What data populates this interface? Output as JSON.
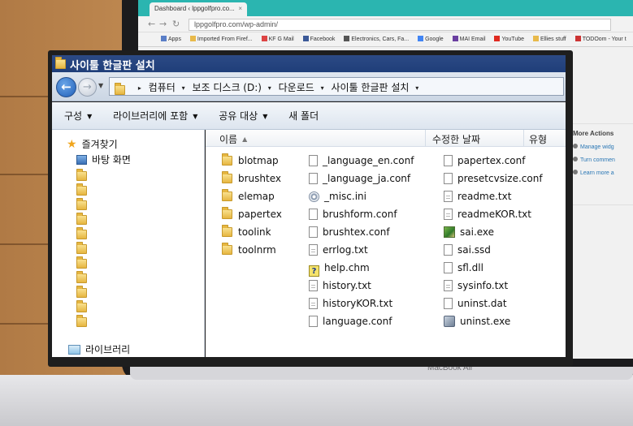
{
  "browser": {
    "tab_title": "Dashboard ‹ lppgolfpro.co...",
    "tab_close": "×",
    "url": "lppgolfpro.com/wp-admin/",
    "bookmarks": [
      "Apps",
      "Imported From Firef...",
      "KF G Mail",
      "Facebook",
      "Electronics, Cars, Fa...",
      "Google",
      "MAI Email",
      "YouTube",
      "Ellies stuff",
      "TODOom - Your t"
    ],
    "sidebar": {
      "heading": "More Actions",
      "links": [
        "Manage widg",
        "Turn commen",
        "Learn more a"
      ]
    }
  },
  "laptop": {
    "label": "MacBook Air"
  },
  "window": {
    "title": "사이툴 한글판 설치",
    "address": [
      "컴퓨터",
      "보조 디스크 (D:)",
      "다운로드",
      "사이툴 한글판 설치"
    ],
    "toolbar": [
      "구성",
      "라이브러리에 포함",
      "공유 대상",
      "새 폴더"
    ],
    "navpane": {
      "favorites": "즐겨찾기",
      "desktop": "바탕 화면",
      "libraries": "라이브러리"
    },
    "columns": {
      "name": "이름",
      "modified": "수정한 날짜",
      "type": "유형"
    },
    "files_col1": [
      "blotmap",
      "brushtex",
      "elemap",
      "papertex",
      "toolink",
      "toolnrm"
    ],
    "files_col2": [
      "_language_en.conf",
      "_language_ja.conf",
      "_misc.ini",
      "brushform.conf",
      "brushtex.conf",
      "errlog.txt",
      "help.chm",
      "history.txt",
      "historyKOR.txt",
      "language.conf"
    ],
    "files_col3": [
      "papertex.conf",
      "presetcvsize.conf",
      "readme.txt",
      "readmeKOR.txt",
      "sai.exe",
      "sai.ssd",
      "sfl.dll",
      "sysinfo.txt",
      "uninst.dat",
      "uninst.exe"
    ]
  },
  "icons": {
    "col2": [
      "doc",
      "doc",
      "cfg",
      "doc",
      "doc",
      "doc-lines",
      "help",
      "doc-lines",
      "doc-lines",
      "doc"
    ],
    "col3": [
      "doc",
      "doc",
      "doc-lines",
      "doc-lines",
      "sai",
      "doc",
      "doc",
      "doc-lines",
      "doc",
      "inst"
    ]
  }
}
